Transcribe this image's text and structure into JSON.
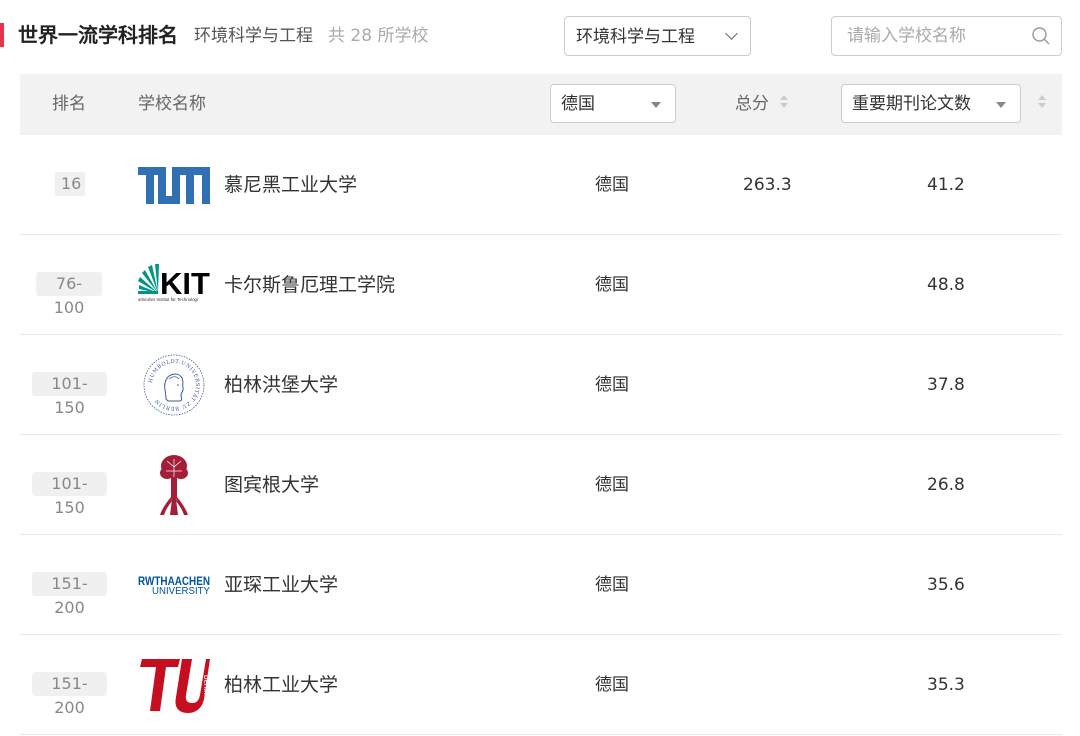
{
  "header": {
    "title": "世界一流学科排名",
    "subject": "环境科学与工程",
    "count_text": "共 28 所学校"
  },
  "subject_select": {
    "value": "环境科学与工程"
  },
  "search": {
    "placeholder": "请输入学校名称"
  },
  "table": {
    "headers": {
      "rank": "排名",
      "name": "学校名称",
      "country_filter": "德国",
      "score": "总分",
      "metric_select": "重要期刊论文数"
    },
    "rows": [
      {
        "rank": "16",
        "logo": "tum-logo",
        "logo_text": "TUM",
        "name": "慕尼黑工业大学",
        "country": "德国",
        "score": "263.3",
        "metric": "41.2"
      },
      {
        "rank": "76-100",
        "logo": "kit-logo",
        "logo_text": "KIT",
        "logo_subtext": "arlsruher Institut für Technologi",
        "name": "卡尔斯鲁厄理工学院",
        "country": "德国",
        "score": "",
        "metric": "48.8"
      },
      {
        "rank": "101-150",
        "logo": "humboldt-seal-logo",
        "logo_text": "HUMBOLDT-UNIVERSITÄT ZU BERLIN",
        "name": "柏林洪堡大学",
        "country": "德国",
        "score": "",
        "metric": "37.8"
      },
      {
        "rank": "101-150",
        "logo": "tuebingen-tree-logo",
        "name": "图宾根大学",
        "country": "德国",
        "score": "",
        "metric": "26.8"
      },
      {
        "rank": "151-200",
        "logo": "rwth-logo",
        "logo_text": "RWTHAACHEN",
        "logo_subtext": "UNIVERSITY",
        "name": "亚琛工业大学",
        "country": "德国",
        "score": "",
        "metric": "35.6"
      },
      {
        "rank": "151-200",
        "logo": "tu-berlin-logo",
        "logo_text": "TU",
        "logo_subtext": "berlin",
        "name": "柏林工业大学",
        "country": "德国",
        "score": "",
        "metric": "35.3"
      }
    ]
  },
  "colors": {
    "accent": "#e8334a",
    "tum_blue": "#3070b3",
    "kit_green": "#009682",
    "humboldt_blue": "#3b5b9a",
    "tuebingen_red": "#a51e37",
    "rwth_blue": "#00549f",
    "tu_berlin_red": "#c50e1f"
  }
}
